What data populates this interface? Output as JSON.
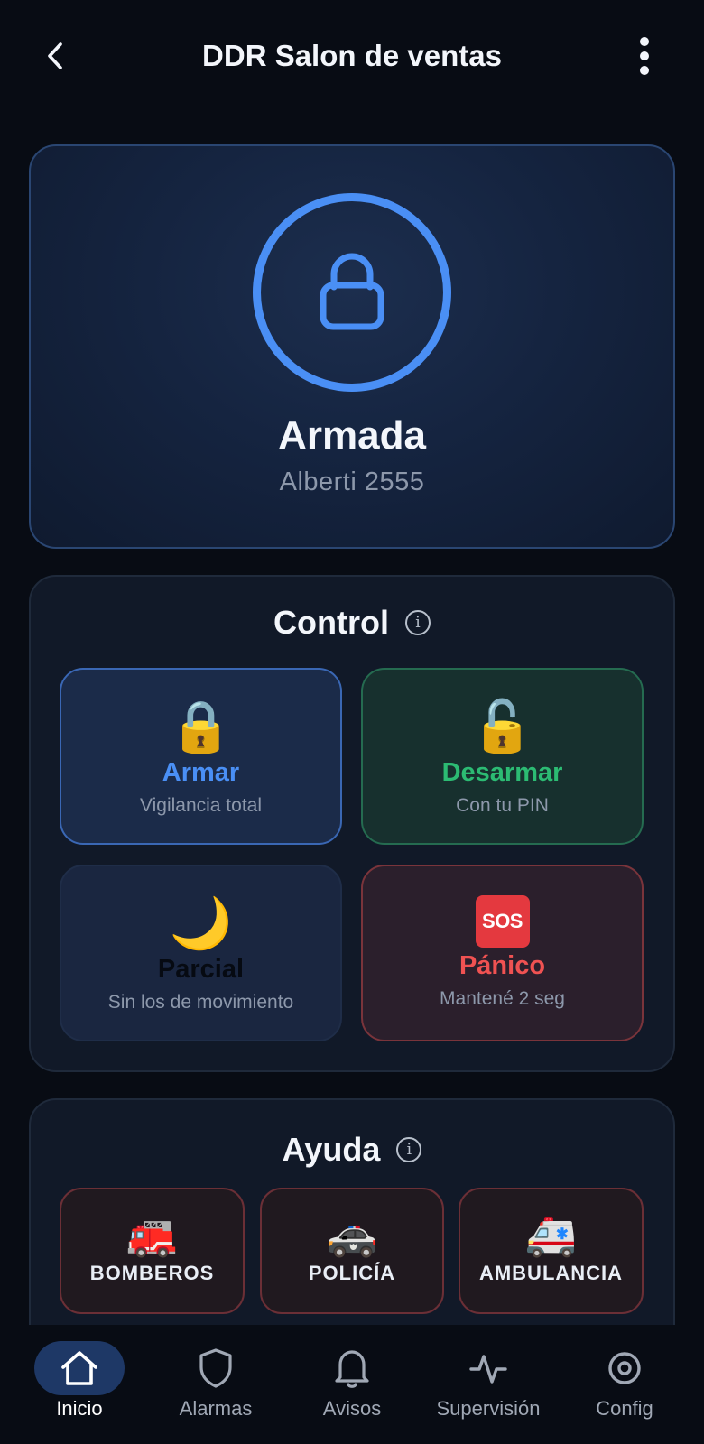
{
  "header": {
    "title": "DDR Salon de ventas",
    "back_icon": "chevron-left-icon",
    "menu_icon": "more-vertical-icon"
  },
  "status": {
    "state": "Armada",
    "address": "Alberti 2555",
    "icon": "lock-icon",
    "accent_color": "#4a8ff5"
  },
  "control": {
    "title": "Control",
    "buttons": [
      {
        "icon": "🔒",
        "label": "Armar",
        "sub": "Vigilancia total",
        "color": "#4a8ff5"
      },
      {
        "icon": "🔓",
        "label": "Desarmar",
        "sub": "Con tu PIN",
        "color": "#2cbb73"
      },
      {
        "icon": "🌙",
        "label": "Parcial",
        "sub": "Sin los de movimiento",
        "color": "#060a12"
      },
      {
        "icon": "SOS",
        "label": "Pánico",
        "sub": "Mantené 2 seg",
        "color": "#f05252"
      }
    ]
  },
  "ayuda": {
    "title": "Ayuda",
    "buttons": [
      {
        "icon": "🚒",
        "label": "BOMBEROS"
      },
      {
        "icon": "🚓",
        "label": "POLICÍA"
      },
      {
        "icon": "🚑",
        "label": "AMBULANCIA"
      }
    ]
  },
  "nav": {
    "items": [
      {
        "label": "Inicio",
        "icon": "home-icon",
        "active": true
      },
      {
        "label": "Alarmas",
        "icon": "shield-icon",
        "active": false
      },
      {
        "label": "Avisos",
        "icon": "bell-icon",
        "active": false
      },
      {
        "label": "Supervisión",
        "icon": "activity-icon",
        "active": false
      },
      {
        "label": "Config",
        "icon": "target-icon",
        "active": false
      }
    ]
  }
}
